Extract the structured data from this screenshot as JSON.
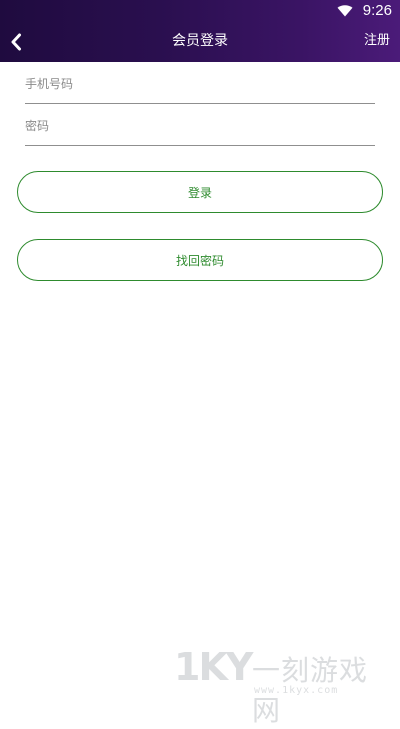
{
  "status_bar": {
    "time": "9:26",
    "wifi_icon": "wifi-icon"
  },
  "navbar": {
    "back_icon": "chevron-left-icon",
    "title": "会员登录",
    "register_label": "注册"
  },
  "form": {
    "phone_placeholder": "手机号码",
    "password_placeholder": "密码",
    "login_label": "登录",
    "recover_label": "找回密码"
  },
  "watermark": {
    "logo": "1KY",
    "name": "一刻游戏网",
    "url": "www.1kyx.com"
  },
  "colors": {
    "navbar_start": "#1f0b3f",
    "navbar_end": "#4b1b79",
    "button_accent": "#2e8b2e"
  }
}
